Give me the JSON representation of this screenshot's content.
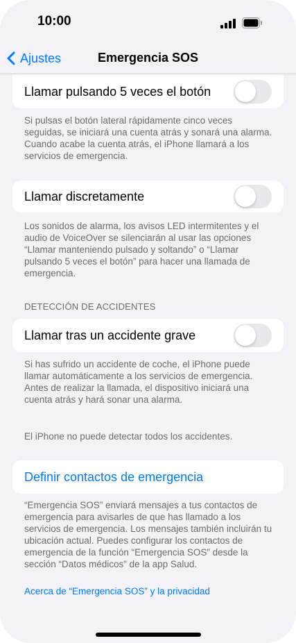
{
  "status_bar": {
    "time": "10:00"
  },
  "nav": {
    "back_label": "Ajustes",
    "title": "Emergencia SOS"
  },
  "rows": {
    "press5": {
      "label": "Llamar pulsando 5 veces el botón",
      "footer": "Si pulsas el botón lateral rápidamente cinco veces seguidas, se iniciará una cuenta atrás y sonará una alarma. Cuando acabe la cuenta atrás, el iPhone llamará a los servicios de emergencia."
    },
    "silent": {
      "label": "Llamar discretamente",
      "footer": "Los sonidos de alarma, los avisos LED intermitentes y el audio de VoiceOver se silenciarán al usar las opciones “Llamar manteniendo pulsado y soltando” o “Llamar pulsando 5 veces el botón” para hacer una llamada de emergencia."
    },
    "crash": {
      "section_header": "DETECCIÓN DE ACCIDENTES",
      "label": "Llamar tras un accidente grave",
      "footer": "Si has sufrido un accidente de coche, el iPhone puede llamar automáticamente a los servicios de emergencia. Antes de realizar la llamada, el dispositivo iniciará una cuenta atrás y hará sonar una alarma.",
      "footer2": "El iPhone no puede detectar todos los accidentes."
    },
    "contacts": {
      "label": "Definir contactos de emergencia",
      "footer": "“Emergencia SOS” enviará mensajes a tus contactos de emergencia para avisarles de que has llamado a los servicios de emergencia. Los mensajes también incluirán tu ubicación actual. Puedes configurar los contactos de emergencia de la función “Emergencia SOS” desde la sección “Datos médicos” de la app Salud.",
      "privacy_link": "Acerca de “Emergencia SOS” y la privacidad"
    }
  },
  "toggles": {
    "press5_on": false,
    "silent_on": false,
    "crash_on": false
  },
  "colors": {
    "accent": "#007aff",
    "background": "#f2f2f7",
    "toggle_off": "#e9e9eb"
  }
}
